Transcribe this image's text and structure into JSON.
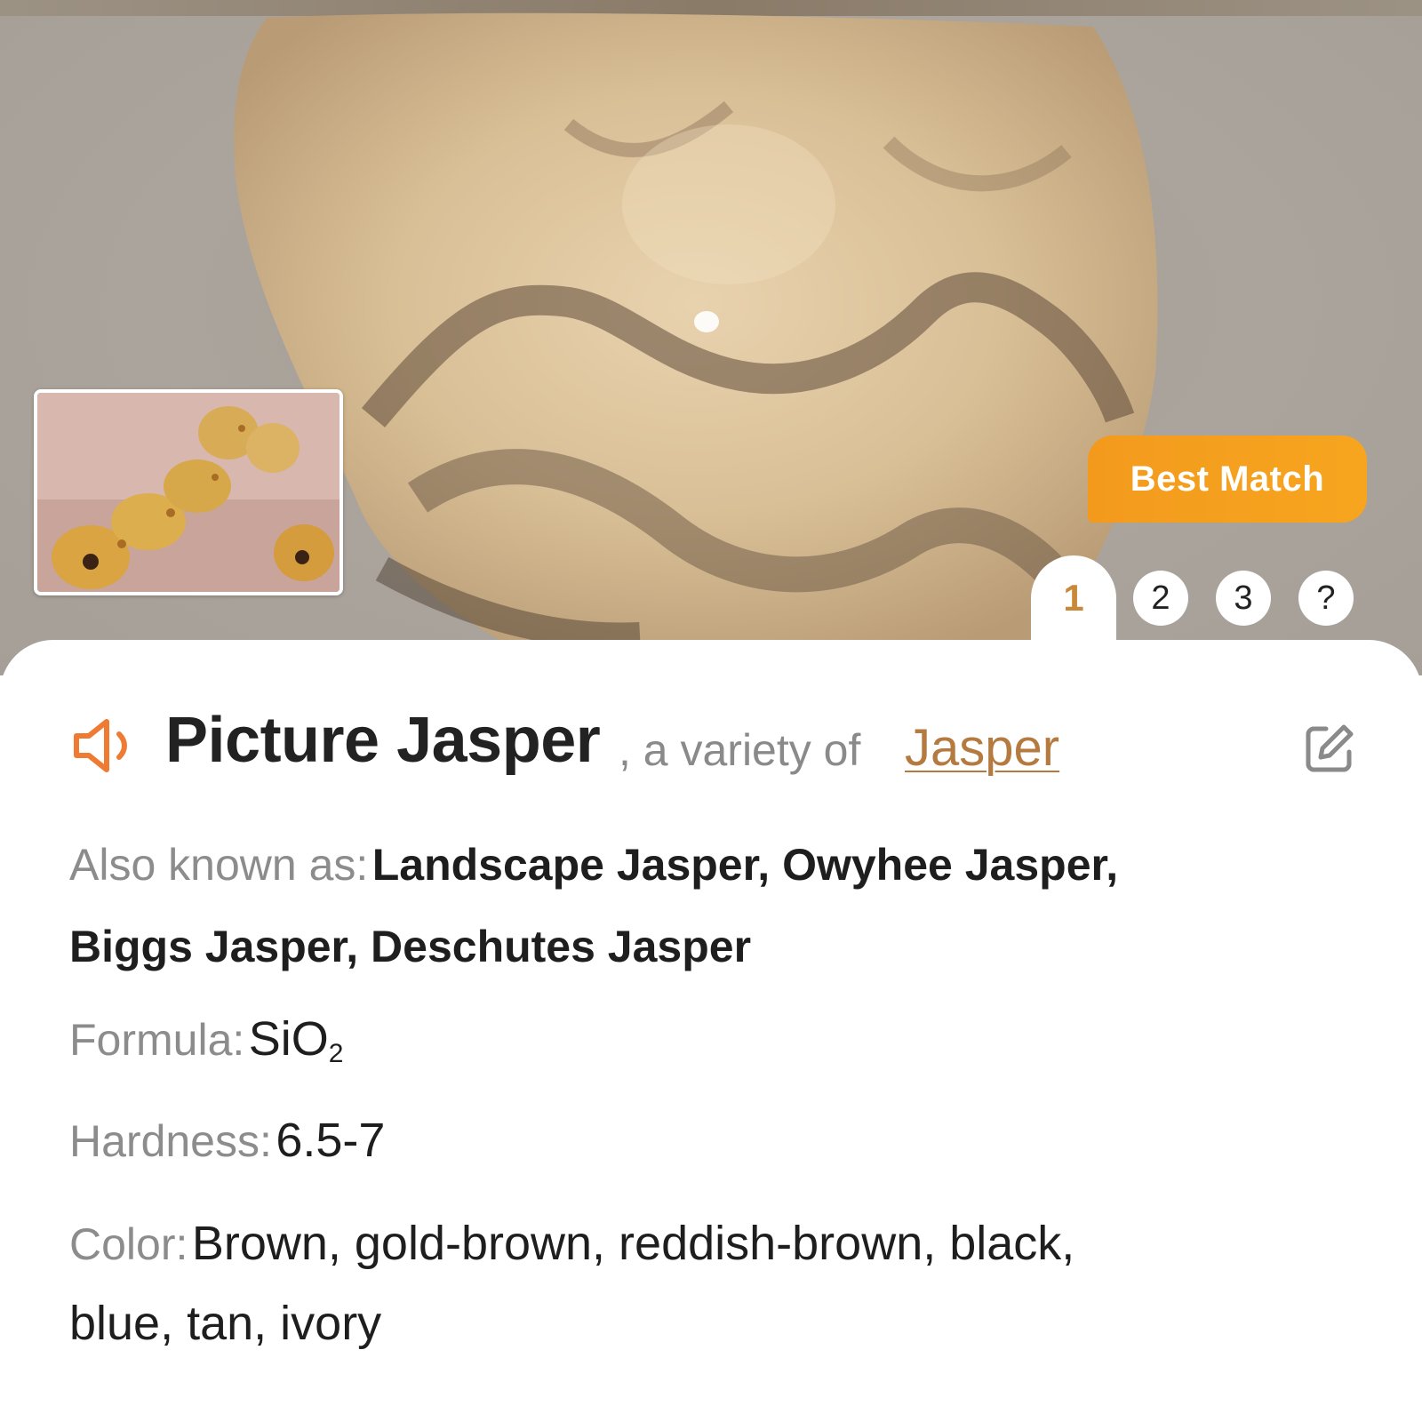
{
  "badge": {
    "label": "Best Match"
  },
  "tabs": {
    "items": [
      "1",
      "2",
      "3",
      "?"
    ]
  },
  "mineral": {
    "name": "Picture Jasper",
    "suffix": ", a variety of",
    "parent": "Jasper"
  },
  "details": {
    "aka_label": "Also known as:",
    "aka_line1": "Landscape Jasper, Owyhee Jasper,",
    "aka_line2": "Biggs Jasper, Deschutes Jasper",
    "formula_label": "Formula:",
    "formula_main": "SiO",
    "formula_sub": "2",
    "hardness_label": "Hardness:",
    "hardness_value": "6.5-7",
    "color_label": "Color:",
    "color_line1": "Brown, gold-brown, reddish-brown, black,",
    "color_line2": "blue, tan, ivory"
  },
  "icons": {
    "speaker": "speaker-icon",
    "edit": "edit-icon"
  },
  "colors": {
    "accent": "#f39a1d",
    "link": "#b47a3f",
    "tab_active": "#c88a3a"
  }
}
